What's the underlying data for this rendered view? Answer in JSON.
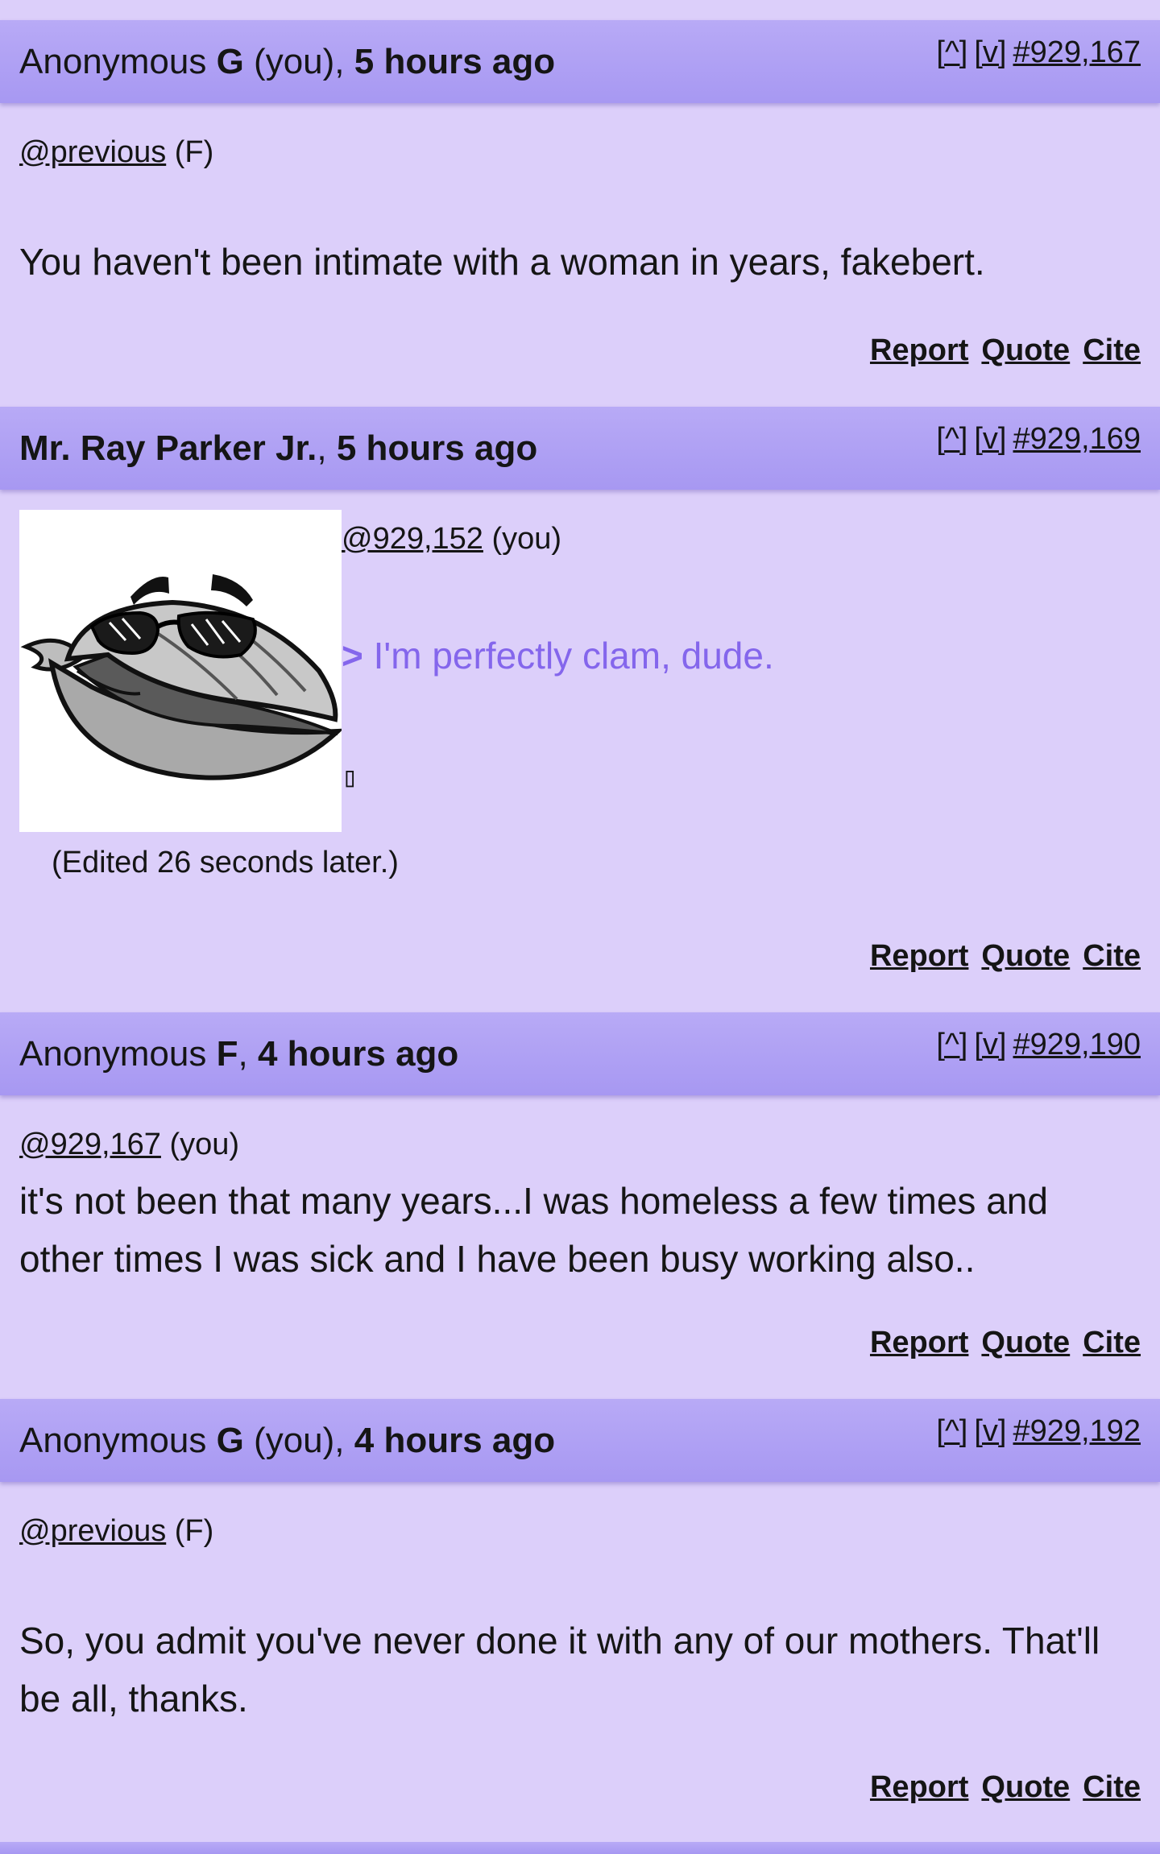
{
  "posts": [
    {
      "name_prefix": "Anonymous ",
      "name_bold": "G",
      "name_suffix": " (you),",
      "time": "5 hours ago",
      "nav_up": "[^]",
      "nav_down": "[v]",
      "post_id": "#929,167",
      "ref_link": "@previous",
      "ref_suffix": " (F)",
      "body": "You haven't been intimate with a woman in years, fakebert."
    },
    {
      "name_bold": "Mr. Ray Parker Jr.",
      "name_suffix": ",",
      "time": "5 hours ago",
      "nav_up": "[^]",
      "nav_down": "[v]",
      "post_id": "#929,169",
      "ref_link": "@929,152",
      "ref_suffix": " (you)",
      "quote_arrow": ">",
      "quote_body": " I'm perfectly clam, dude.",
      "glyph": "▯",
      "edited": "(Edited 26 seconds later.)",
      "image_name": "clam-with-sunglasses-image"
    },
    {
      "name_prefix": "Anonymous ",
      "name_bold": "F",
      "name_suffix": ",",
      "time": "4 hours ago",
      "nav_up": "[^]",
      "nav_down": "[v]",
      "post_id": "#929,190",
      "ref_link": "@929,167",
      "ref_suffix": " (you)",
      "body_line1": "it's not been that many years...I was homeless a few times and",
      "body_line2": "other times I was sick and I have been busy working also.."
    },
    {
      "name_prefix": "Anonymous ",
      "name_bold": "G",
      "name_suffix": " (you),",
      "time": "4 hours ago",
      "nav_up": "[^]",
      "nav_down": "[v]",
      "post_id": "#929,192",
      "ref_link": "@previous",
      "ref_suffix": " (F)",
      "body_line1": "So, you admit you've never done it with any of our mothers. That'll",
      "body_line2": "be all, thanks."
    }
  ],
  "actions": {
    "report": "Report",
    "quote": "Quote",
    "cite": "Cite"
  },
  "colors": {
    "background": "#dccffa",
    "header": "#a798f2",
    "greentext": "#8466ec"
  }
}
